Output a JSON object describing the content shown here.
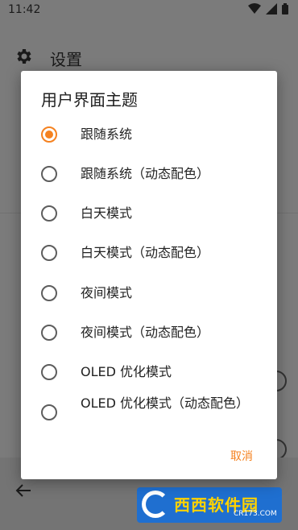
{
  "status": {
    "time": "11:42"
  },
  "appbar": {
    "title": "设置"
  },
  "dialog": {
    "title": "用户界面主题",
    "options": [
      {
        "label": "跟随系统",
        "selected": true
      },
      {
        "label": "跟随系统（动态配色）",
        "selected": false
      },
      {
        "label": "白天模式",
        "selected": false
      },
      {
        "label": "白天模式（动态配色）",
        "selected": false
      },
      {
        "label": "夜间模式",
        "selected": false
      },
      {
        "label": "夜间模式（动态配色）",
        "selected": false
      },
      {
        "label": "OLED 优化模式",
        "selected": false
      },
      {
        "label": "OLED 优化模式（动态配色）",
        "selected": false
      }
    ],
    "cancel_label": "取消"
  },
  "watermark": {
    "text": "西西软件园",
    "sub": "CR173.COM"
  },
  "colors": {
    "accent": "#f58220",
    "dialog_bg": "#ffffff",
    "scrim": "#7b7b7b"
  }
}
